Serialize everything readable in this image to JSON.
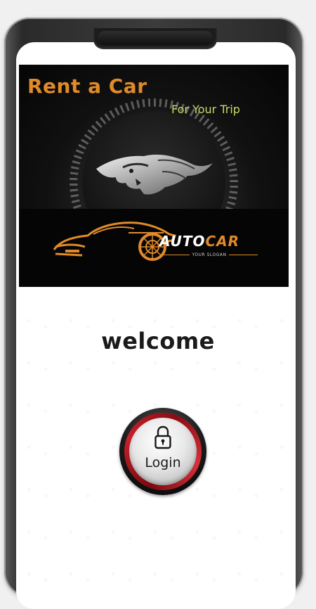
{
  "banner": {
    "title": "Rent a Car",
    "subtitle": "For Your Trip",
    "brand_part1": "AUTO",
    "brand_part2": "CAR",
    "slogan": "YOUR SLOGAN"
  },
  "welcome_text": "welcome",
  "login": {
    "label": "Login"
  },
  "colors": {
    "accent_orange": "#e08a2a",
    "subtitle_green": "#c8d86a",
    "login_ring_red": "#c8202a"
  },
  "icons": [
    "lion-emblem-icon",
    "sports-car-icon",
    "lock-icon"
  ]
}
